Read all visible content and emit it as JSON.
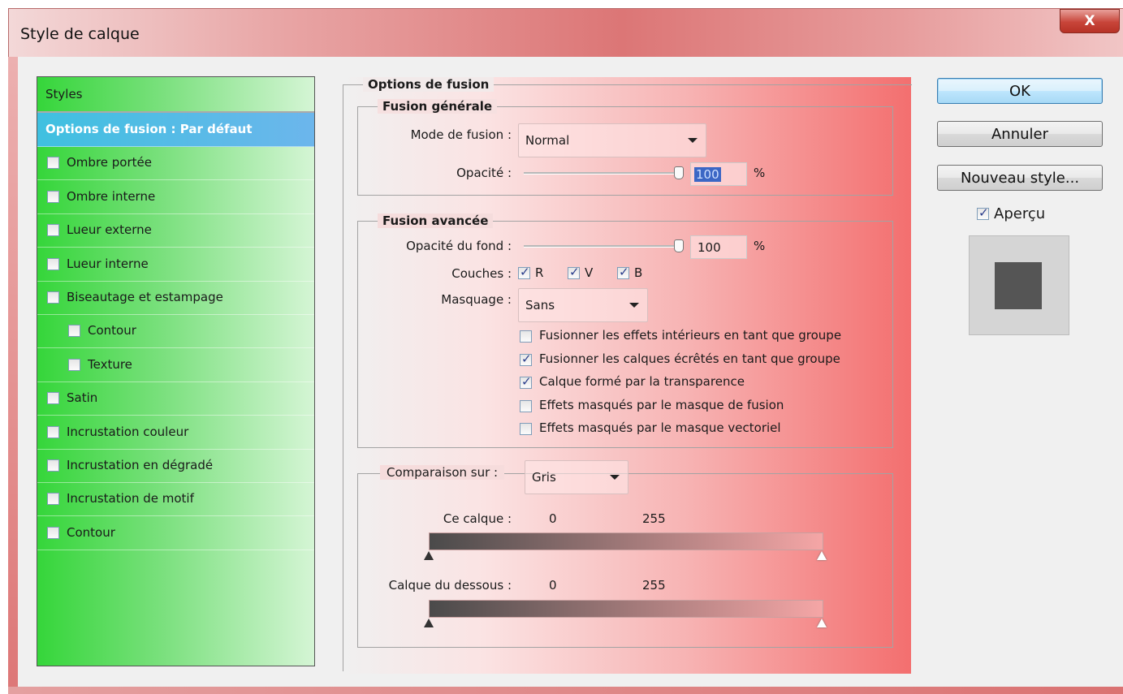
{
  "window": {
    "title": "Style de calque",
    "close_label": "X"
  },
  "styles_panel": {
    "header": "Styles",
    "items": [
      {
        "label": "Options de fusion : Par défaut",
        "checkbox": false,
        "selected": true,
        "indent": 0
      },
      {
        "label": "Ombre portée",
        "checkbox": true,
        "checked": false,
        "indent": 0
      },
      {
        "label": "Ombre interne",
        "checkbox": true,
        "checked": false,
        "indent": 0
      },
      {
        "label": "Lueur externe",
        "checkbox": true,
        "checked": false,
        "indent": 0
      },
      {
        "label": "Lueur interne",
        "checkbox": true,
        "checked": false,
        "indent": 0
      },
      {
        "label": "Biseautage et estampage",
        "checkbox": true,
        "checked": false,
        "indent": 0
      },
      {
        "label": "Contour",
        "checkbox": true,
        "checked": false,
        "indent": 1
      },
      {
        "label": "Texture",
        "checkbox": true,
        "checked": false,
        "indent": 1
      },
      {
        "label": "Satin",
        "checkbox": true,
        "checked": false,
        "indent": 0
      },
      {
        "label": "Incrustation couleur",
        "checkbox": true,
        "checked": false,
        "indent": 0
      },
      {
        "label": "Incrustation en dégradé",
        "checkbox": true,
        "checked": false,
        "indent": 0
      },
      {
        "label": "Incrustation de motif",
        "checkbox": true,
        "checked": false,
        "indent": 0
      },
      {
        "label": "Contour",
        "checkbox": true,
        "checked": false,
        "indent": 0
      }
    ]
  },
  "options": {
    "title": "Options de fusion",
    "general": {
      "legend": "Fusion générale",
      "mode_label": "Mode de fusion :",
      "mode_value": "Normal",
      "opacity_label": "Opacité :",
      "opacity_value": "100",
      "opacity_unit": "%",
      "opacity_level": 1.0
    },
    "advanced": {
      "legend": "Fusion avancée",
      "fill_opacity_label": "Opacité du fond :",
      "fill_opacity_value": "100",
      "fill_opacity_unit": "%",
      "fill_opacity_level": 1.0,
      "channels_label": "Couches :",
      "channels": [
        {
          "label": "R",
          "checked": true
        },
        {
          "label": "V",
          "checked": true
        },
        {
          "label": "B",
          "checked": true
        }
      ],
      "knockout_label": "Masquage :",
      "knockout_value": "Sans",
      "checkboxes": [
        {
          "label": "Fusionner les effets intérieurs en tant que groupe",
          "checked": false
        },
        {
          "label": "Fusionner les calques écrêtés en tant que groupe",
          "checked": true
        },
        {
          "label": "Calque formé par la transparence",
          "checked": true
        },
        {
          "label": "Effets masqués par le masque de fusion",
          "checked": false
        },
        {
          "label": "Effets masqués par le masque vectoriel",
          "checked": false
        }
      ]
    },
    "blend_if": {
      "label": "Comparaison sur :",
      "value": "Gris",
      "this_layer_label": "Ce calque :",
      "this_layer_min": "0",
      "this_layer_max": "255",
      "underlying_label": "Calque du dessous :",
      "underlying_min": "0",
      "underlying_max": "255"
    }
  },
  "buttons": {
    "ok": "OK",
    "cancel": "Annuler",
    "new_style": "Nouveau style...",
    "preview_label": "Aperçu",
    "preview_checked": true
  },
  "colors": {
    "styles_panel_green": "#35d63a",
    "selected_item": "#6cb6ec",
    "options_red": "#f36f6f",
    "preview_swatch": "#555555"
  }
}
